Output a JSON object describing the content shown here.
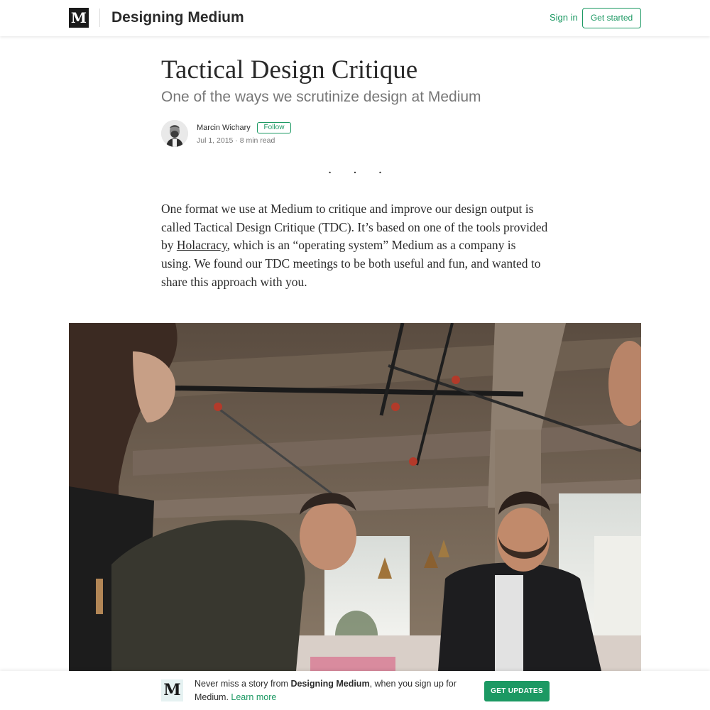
{
  "header": {
    "logo_letter": "M",
    "publication_name": "Designing Medium",
    "sign_in_label": "Sign in",
    "get_started_label": "Get started"
  },
  "article": {
    "title": "Tactical Design Critique",
    "subtitle": "One of the ways we scrutinize design at Medium",
    "author": {
      "name": "Marcin Wichary",
      "follow_label": "Follow",
      "date": "Jul 1, 2015",
      "meta_separator": " · ",
      "read_time": "8 min read"
    },
    "separator": "· · ·",
    "body": {
      "text_before_link": "One format we use at Medium to critique and improve our design output is called Tactical Design Critique (TDC). It’s based on one of the tools provided by ",
      "link_text": "Holacracy",
      "text_after_link": ", which is an “operating system” Medium as a company is using. We found our TDC meetings to be both useful and fun, and wanted to share this approach with you."
    }
  },
  "bottom_bar": {
    "logo_letter": "M",
    "text_prefix": "Never miss a story from ",
    "publication_name": "Designing Medium",
    "text_suffix": ", when you sign up for Medium. ",
    "learn_more_label": "Learn more",
    "cta_label": "GET UPDATES"
  },
  "colors": {
    "accent": "#1c9963",
    "text": "#1f1f1f"
  }
}
